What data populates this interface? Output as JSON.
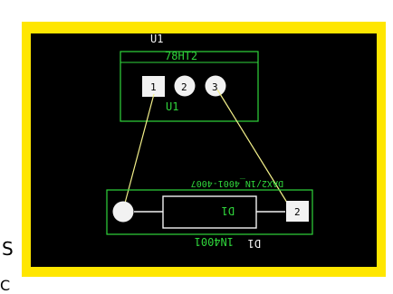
{
  "colors": {
    "board_outline": "#ffe600",
    "board_fill": "#000000",
    "silkscreen": "#2fd43b",
    "pad_fill": "#f2f2f2",
    "ratsnest": "#f3f08a",
    "outside": "#ffffff"
  },
  "board": {
    "components": [
      {
        "id": "u1",
        "name_label": "U1",
        "value_label": "78HT2",
        "inner_label": "U1",
        "pads": [
          "1",
          "2",
          "3"
        ]
      },
      {
        "id": "d1",
        "name_label": "D1",
        "outer_label": "D1",
        "value_label": "1N4001",
        "mirrored_label": "DAX2/1N_4001-4007",
        "pads": [
          "",
          "2"
        ]
      }
    ],
    "edge_text": {
      "left": "S",
      "bottom": "C"
    }
  }
}
